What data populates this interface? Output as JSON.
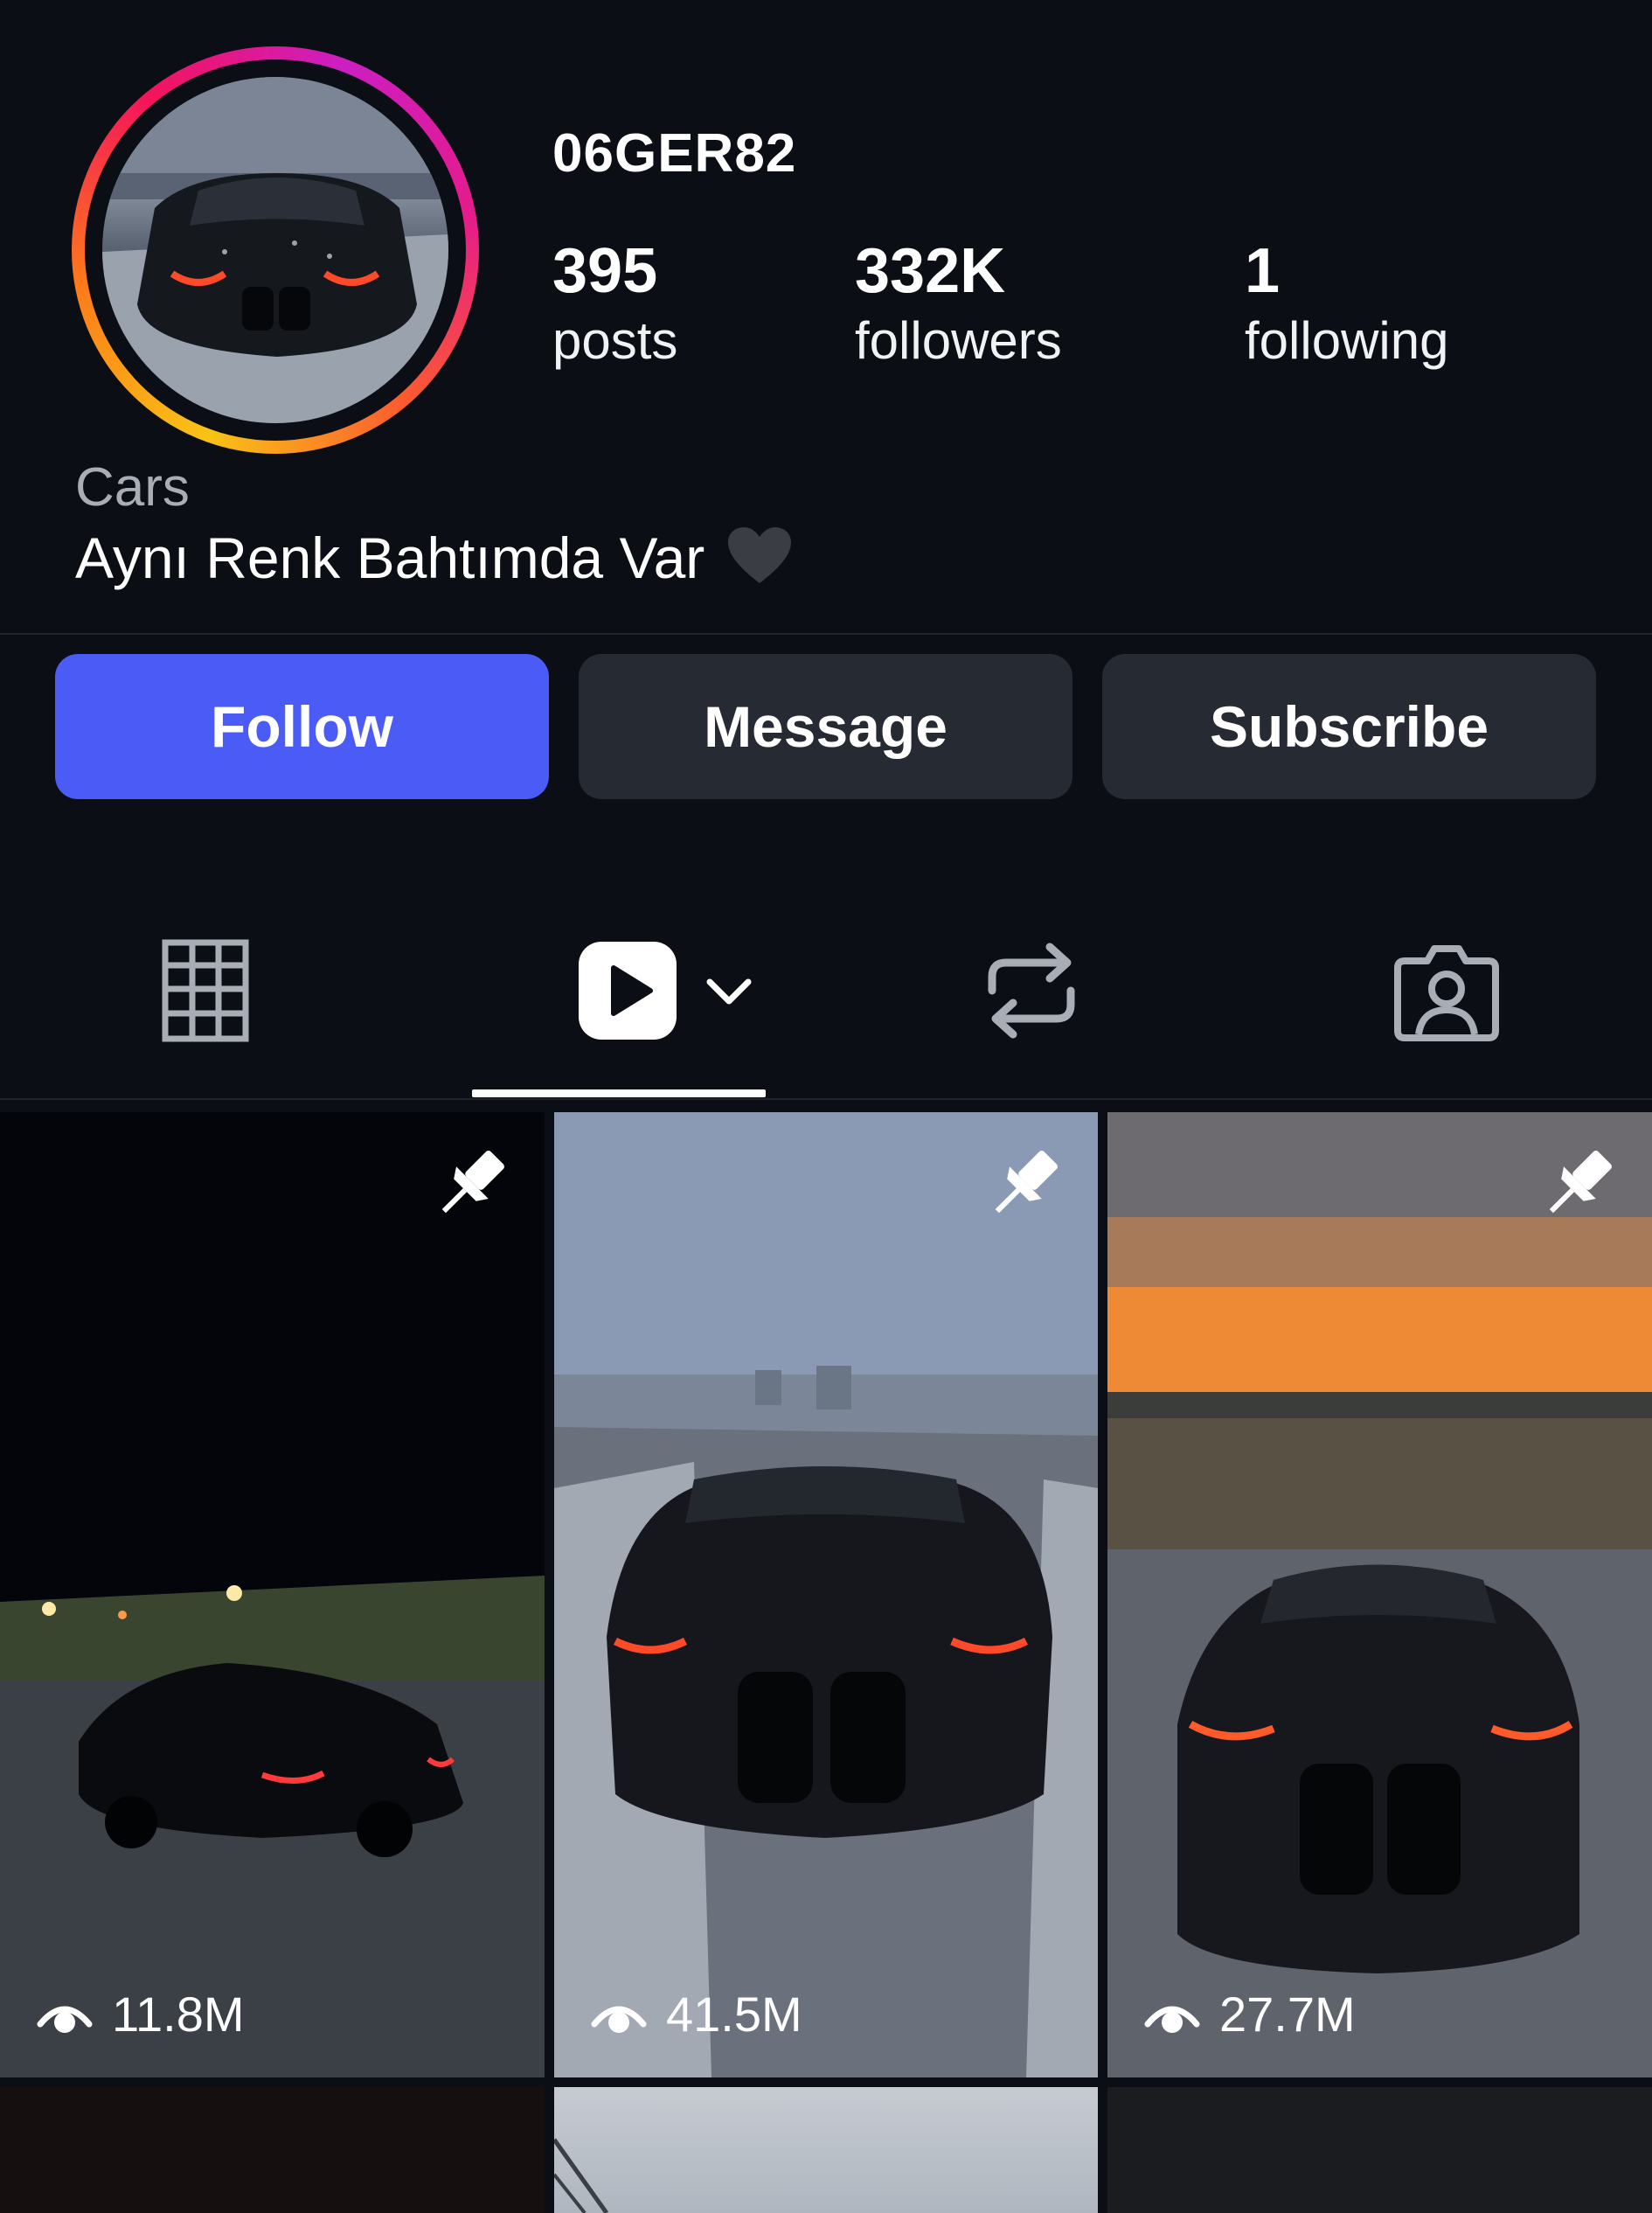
{
  "profile": {
    "username": "06GER82",
    "stats": [
      {
        "value": "395",
        "label": "posts"
      },
      {
        "value": "332K",
        "label": "followers"
      },
      {
        "value": "1",
        "label": "following"
      }
    ],
    "category": "Cars",
    "bio": "Aynı Renk Bahtımda Var",
    "bio_emoji": "black-heart-icon"
  },
  "actions": {
    "follow_label": "Follow",
    "message_label": "Message",
    "subscribe_label": "Subscribe",
    "follow_color": "#4a5cf5"
  },
  "tabs": [
    {
      "icon": "grid-icon",
      "selected": false
    },
    {
      "icon": "reels-play-icon",
      "selected": true
    },
    {
      "icon": "repost-icon",
      "selected": false
    },
    {
      "icon": "tagged-person-icon",
      "selected": false
    }
  ],
  "posts": [
    {
      "views": "11.8M",
      "pinned": true,
      "scene": "night parking lot, black car with red headlights"
    },
    {
      "views": "41.5M",
      "pinned": true,
      "scene": "snowy road, black car front view"
    },
    {
      "views": "27.7M",
      "pinned": true,
      "scene": "orange sunset sky, black car front view"
    }
  ],
  "colors": {
    "background": "#0b0e14",
    "button_dark": "#262a32",
    "accent_blue": "#4a5cf5"
  }
}
